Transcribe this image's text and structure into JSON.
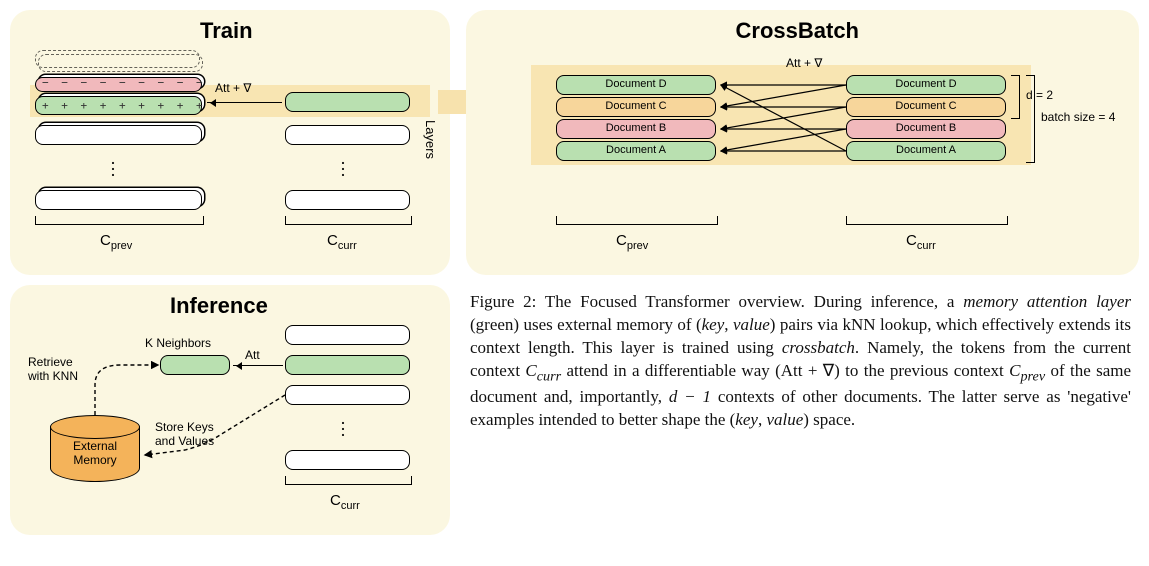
{
  "titles": {
    "train": "Train",
    "crossbatch": "CrossBatch",
    "inference": "Inference"
  },
  "train": {
    "att_label": "Att + ∇",
    "layers_label": "Layers",
    "c_prev": "C",
    "c_prev_sub": "prev",
    "c_curr": "C",
    "c_curr_sub": "curr",
    "pos_row": "+ + + + + + + + +",
    "neg_row": "− − − − − − − − −"
  },
  "crossbatch": {
    "att_label": "Att + ∇",
    "docs": [
      "Document D",
      "Document C",
      "Document B",
      "Document A"
    ],
    "d_label": "d = 2",
    "batch_label": "batch size = 4",
    "c_prev": "C",
    "c_prev_sub": "prev",
    "c_curr": "C",
    "c_curr_sub": "curr"
  },
  "inference": {
    "kneighbors": "K Neighbors",
    "att_label": "Att",
    "retrieve": "Retrieve\nwith KNN",
    "store": "Store Keys\nand Values",
    "memory_label": "External\nMemory",
    "c_curr": "C",
    "c_curr_sub": "curr"
  },
  "caption": {
    "fig_label": "Figure 2:",
    "text1": " The Focused Transformer overview. During inference, a ",
    "em1": "memory attention layer",
    "text2": " (green) uses external memory of (",
    "kv1a": "key",
    "kv1b": "value",
    "text3": ") pairs via kNN lookup, which effectively extends its context length. This layer is trained using ",
    "em2": "crossbatch",
    "text4": ". Namely, the tokens from the current context ",
    "Ccurr": "C",
    "Ccurr_sub": "curr",
    "text5": " attend in a differentiable way (Att + ∇) to the previous context ",
    "Cprev": "C",
    "Cprev_sub": "prev",
    "text6": " of the same document and, importantly, ",
    "dminus1": "d − 1",
    "text7": " contexts of other documents. The latter serve as 'negative' examples intended to better shape the (",
    "kv2a": "key",
    "kv2b": "value",
    "text8": ") space."
  }
}
